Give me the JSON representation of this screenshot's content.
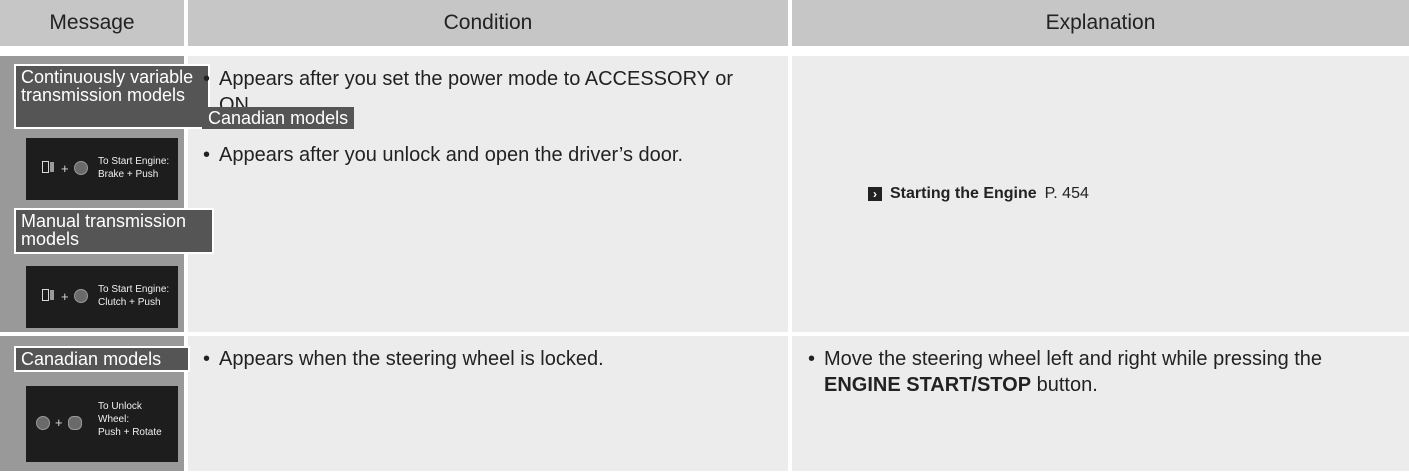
{
  "header": {
    "col_message": "Message",
    "col_condition": "Condition",
    "col_explanation": "Explanation"
  },
  "row1": {
    "label_cvt": "Continuously variable transmission models",
    "panel_cvt_text_1": "To Start Engine:",
    "panel_cvt_text_2": "Brake + Push",
    "label_manual": "Manual transmission models",
    "panel_manual_text_1": "To Start Engine:",
    "panel_manual_text_2": "Clutch + Push",
    "condition_1": "Appears after you set the power mode to ACCESSORY or ON.",
    "canadian_tag": "Canadian models",
    "condition_2": "Appears after you unlock and open the driver’s door.",
    "xref_title": "Starting the Engine",
    "xref_page": "P. 454"
  },
  "row2": {
    "label_canadian": "Canadian models",
    "panel_text_1": "To Unlock",
    "panel_text_2": "Wheel:",
    "panel_text_3": "Push + Rotate",
    "condition": "Appears when the steering wheel is locked.",
    "explanation_pre": "Move the steering wheel left and right while pressing the ",
    "explanation_bold": "ENGINE START/STOP",
    "explanation_post": " button."
  },
  "icons": {
    "bullet": "•",
    "xref_arrow": "arrow-right-icon",
    "plus": "+"
  }
}
